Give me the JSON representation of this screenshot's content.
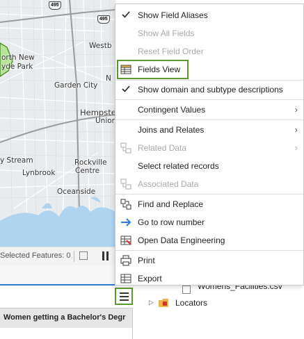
{
  "map": {
    "labels": {
      "north_new": "orth New",
      "hyde_park": "yde Park",
      "garden_city": "Garden City",
      "hempstead": "Hempstead",
      "union": "Unior",
      "stream": "y Stream",
      "lynbrook": "Lynbrook",
      "rockville": "Rockville",
      "centre": "Centre",
      "oceanside": "Oceanside",
      "westbury": "Westb",
      "n_edge": "N"
    },
    "shields": {
      "i495a": "495",
      "i495b": "495"
    }
  },
  "status_bar": {
    "selected_features": "Selected Features: 0"
  },
  "table": {
    "column_header": "Women getting a Bachelor's Degr"
  },
  "catalog": {
    "file_item": "Womens_Facilities.csv",
    "locators": "Locators"
  },
  "menu": {
    "items": [
      {
        "label": "Show Field Aliases",
        "checked": true,
        "enabled": true
      },
      {
        "label": "Show All Fields",
        "enabled": false
      },
      {
        "label": "Reset Field Order",
        "enabled": false
      },
      {
        "label": "Fields View",
        "enabled": true,
        "icon": "fields-view-icon",
        "highlighted": true
      },
      {
        "label": "Show domain and subtype descriptions",
        "checked": true,
        "enabled": true
      },
      {
        "label": "Contingent Values",
        "enabled": true,
        "submenu": true
      },
      {
        "label": "Joins and Relates",
        "enabled": true,
        "submenu": true,
        "icon": "joins-icon"
      },
      {
        "label": "Related Data",
        "enabled": false,
        "submenu": true,
        "icon": "related-data-icon"
      },
      {
        "label": "Select related records",
        "enabled": true
      },
      {
        "label": "Associated Data",
        "enabled": false,
        "icon": "associated-data-icon"
      },
      {
        "label": "Find and Replace",
        "enabled": true,
        "icon": "find-replace-icon"
      },
      {
        "label": "Go to row number",
        "enabled": true,
        "icon": "arrow-right-icon"
      },
      {
        "label": "Open Data Engineering",
        "enabled": true,
        "icon": "data-engineering-icon"
      },
      {
        "label": "Print",
        "enabled": true,
        "icon": "print-icon"
      },
      {
        "label": "Export",
        "enabled": true,
        "icon": "export-table-icon"
      }
    ]
  },
  "colors": {
    "highlight_border": "#5a9a2c",
    "water": "#aed4f0",
    "park": "#b7e39a",
    "selection_line": "#2b7cd3"
  }
}
